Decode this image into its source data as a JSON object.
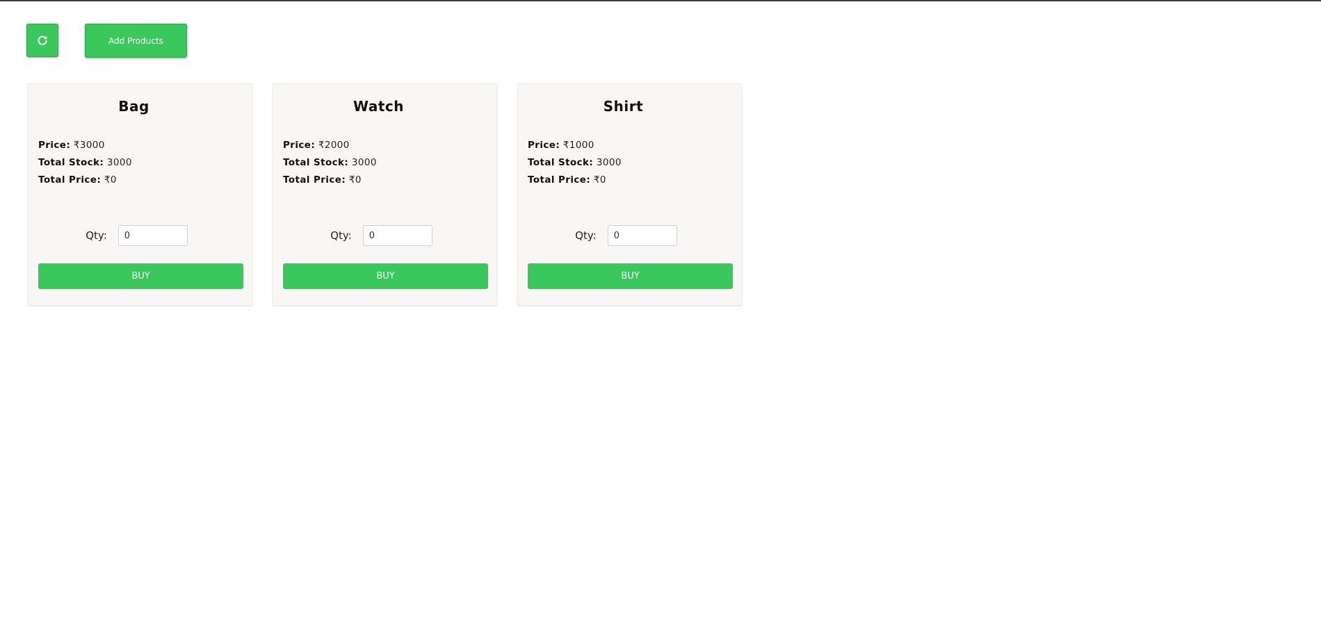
{
  "toolbar": {
    "refresh_icon": "refresh-icon",
    "add_products_label": "Add Products"
  },
  "colors": {
    "accent": "#3ac85c",
    "card_bg": "#f8f7f5"
  },
  "labels": {
    "price": "Price:",
    "total_stock": "Total Stock:",
    "total_price": "Total Price:",
    "qty": "Qty:",
    "buy": "BUY"
  },
  "products": [
    {
      "name": "Bag",
      "price": "₹3000",
      "total_stock": "3000",
      "total_price": "₹0",
      "qty": "0"
    },
    {
      "name": "Watch",
      "price": "₹2000",
      "total_stock": "3000",
      "total_price": "₹0",
      "qty": "0"
    },
    {
      "name": "Shirt",
      "price": "₹1000",
      "total_stock": "3000",
      "total_price": "₹0",
      "qty": "0"
    }
  ]
}
